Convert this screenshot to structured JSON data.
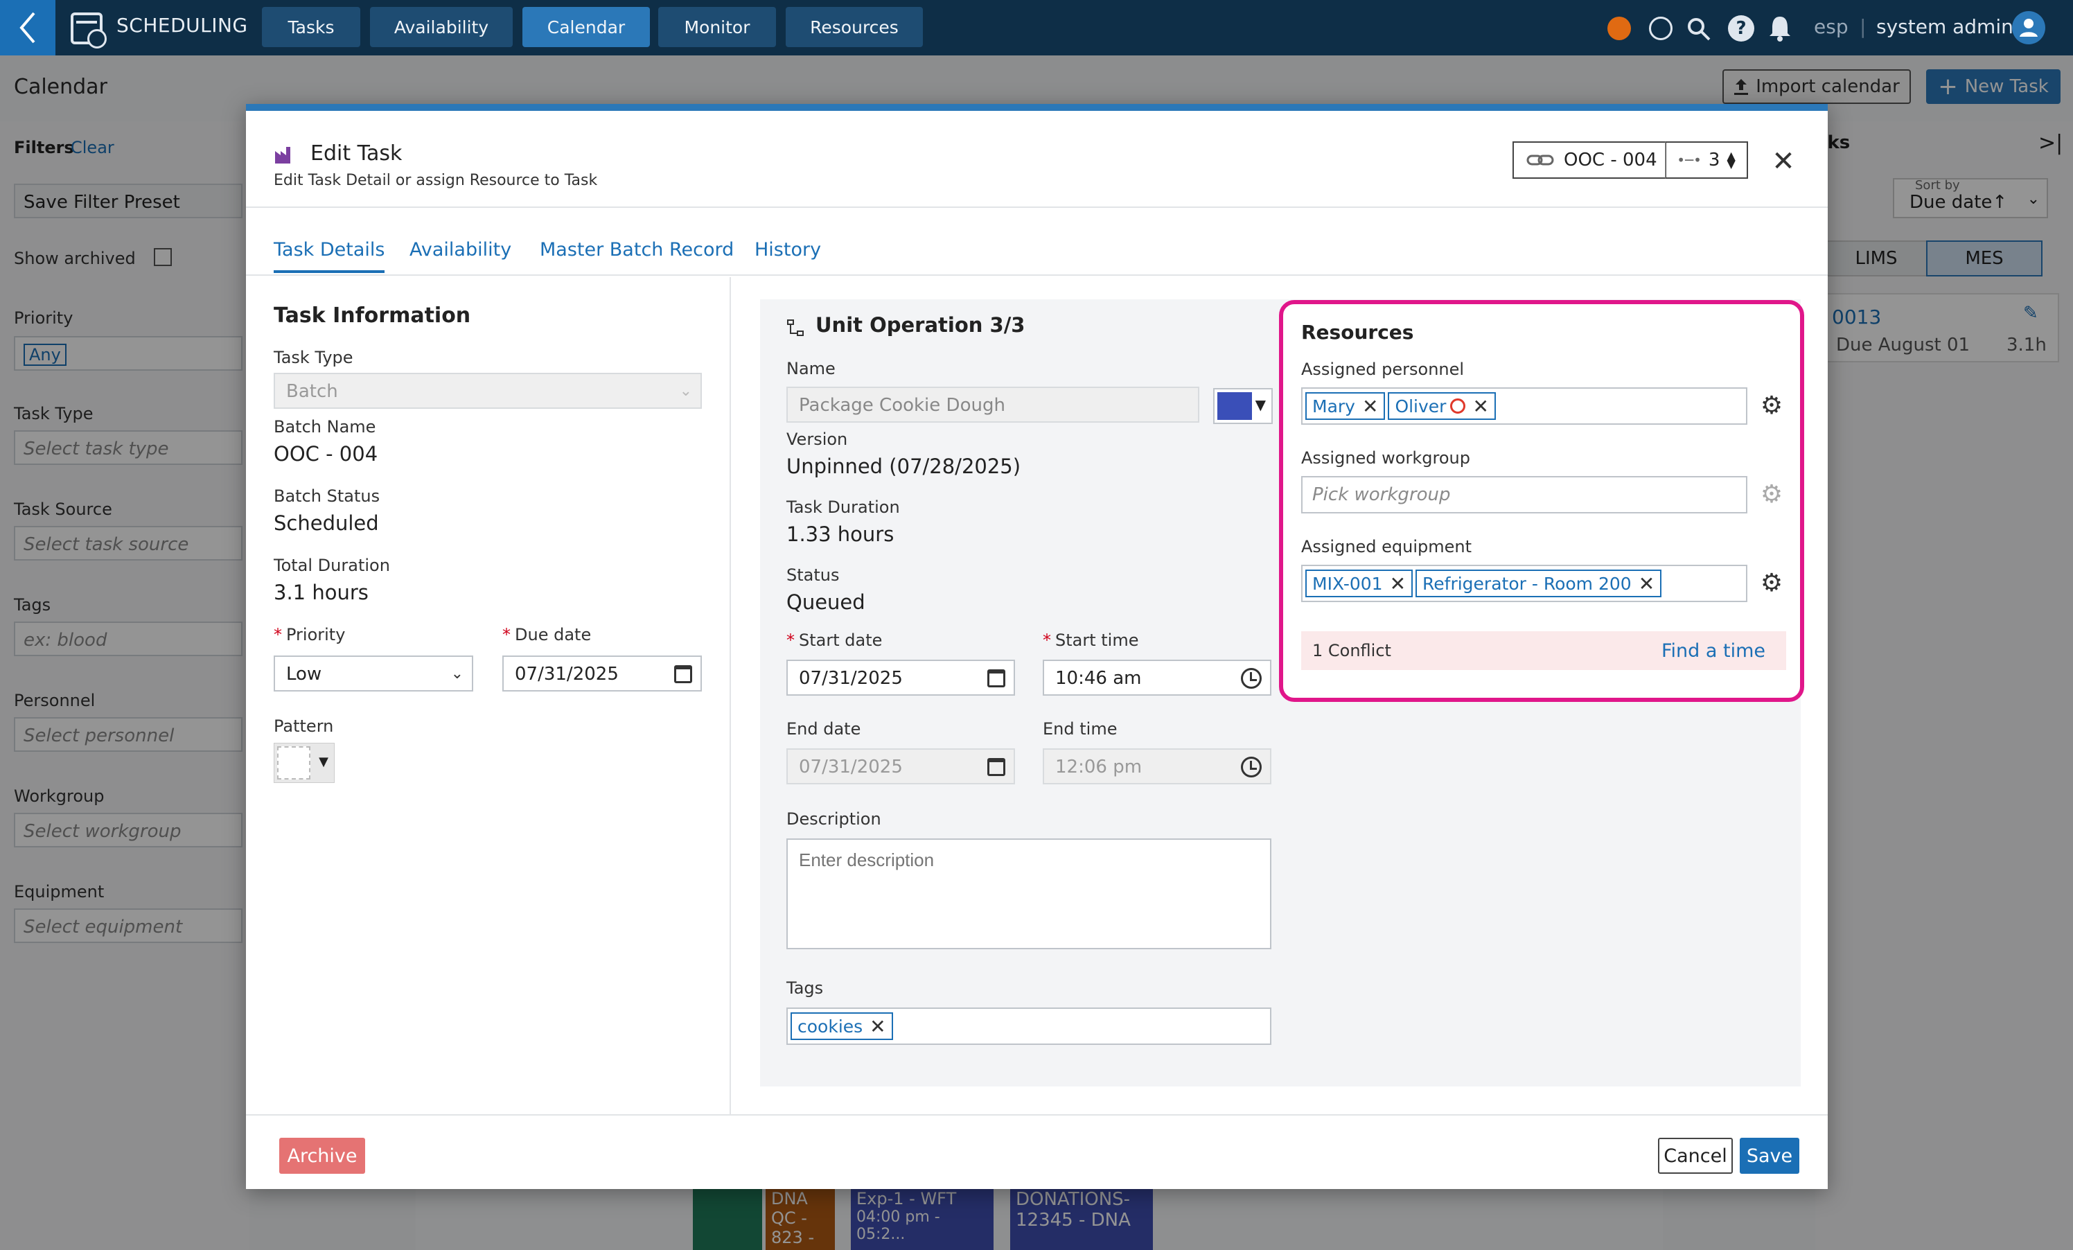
{
  "app": {
    "title": "SCHEDULING",
    "nav": [
      "Tasks",
      "Availability",
      "Calendar",
      "Monitor",
      "Resources"
    ],
    "active_nav": "Calendar",
    "language": "esp",
    "user": "system admin"
  },
  "page": {
    "title": "Calendar",
    "import_label": "Import calendar",
    "new_task_label": "New Task"
  },
  "sidebar": {
    "filters_label": "Filters",
    "clear_label": "Clear",
    "save_preset_label": "Save Filter Preset",
    "show_archived_label": "Show archived",
    "priority_label": "Priority",
    "priority_value": "Any",
    "task_type_label": "Task Type",
    "task_type_ph": "Select task type",
    "task_source_label": "Task Source",
    "task_source_ph": "Select task source",
    "tags_label": "Tags",
    "tags_ph": "ex: blood",
    "personnel_label": "Personnel",
    "personnel_ph": "Select personnel",
    "workgroup_label": "Workgroup",
    "workgroup_ph": "Select workgroup",
    "equipment_label": "Equipment",
    "equipment_ph": "Select equipment"
  },
  "right_panel": {
    "sort_by_label": "Sort by",
    "sort_value": "Due date↑",
    "tab_lims": "LIMS",
    "tab_mes": "MES",
    "task_id": "0013",
    "task_due": "Due August 01",
    "task_hours": "3.1h"
  },
  "modal": {
    "title": "Edit Task",
    "subtitle": "Edit Task Detail or assign Resource to Task",
    "batch_id": "OOC - 004",
    "sequence": "3",
    "tabs": [
      "Task Details",
      "Availability",
      "Master Batch Record",
      "History"
    ],
    "task_info": {
      "heading": "Task Information",
      "task_type_label": "Task Type",
      "task_type_value": "Batch",
      "batch_name_label": "Batch Name",
      "batch_name_value": "OOC - 004",
      "batch_status_label": "Batch Status",
      "batch_status_value": "Scheduled",
      "total_duration_label": "Total Duration",
      "total_duration_value": "3.1 hours",
      "priority_label": "Priority",
      "priority_value": "Low",
      "due_date_label": "Due date",
      "due_date_value": "07/31/2025",
      "pattern_label": "Pattern"
    },
    "unit_op": {
      "heading": "Unit Operation 3/3",
      "name_label": "Name",
      "name_value": "Package Cookie Dough",
      "color": "#3a4fb8",
      "version_label": "Version",
      "version_value": "Unpinned (07/28/2025)",
      "duration_label": "Task Duration",
      "duration_value": "1.33 hours",
      "status_label": "Status",
      "status_value": "Queued",
      "start_date_label": "Start date",
      "start_date_value": "07/31/2025",
      "start_time_label": "Start time",
      "start_time_value": "10:46 am",
      "end_date_label": "End date",
      "end_date_value": "07/31/2025",
      "end_time_label": "End time",
      "end_time_value": "12:06 pm",
      "description_label": "Description",
      "description_ph": "Enter description",
      "tags_label": "Tags",
      "tags": [
        "cookies"
      ]
    },
    "resources": {
      "heading": "Resources",
      "personnel_label": "Assigned personnel",
      "personnel": [
        "Mary",
        "Oliver"
      ],
      "workgroup_label": "Assigned workgroup",
      "workgroup_ph": "Pick workgroup",
      "equipment_label": "Assigned equipment",
      "equipment": [
        "MIX-001",
        "Refrigerator - Room 200"
      ],
      "conflict_text": "1 Conflict",
      "find_time_label": "Find a time"
    },
    "archive_label": "Archive",
    "cancel_label": "Cancel",
    "save_label": "Save"
  },
  "calendar_bg": {
    "event1": "DNA QC - 823 -",
    "event2_title": "Exp-1 - WFT",
    "event2_time": "04:00 pm - 05:2...",
    "event3": "DONATIONS- 12345 - DNA"
  },
  "colors": {
    "accent": "#2b78b8",
    "topbar": "#0e2e47",
    "highlight": "#e0168a",
    "archive": "#e57373"
  }
}
